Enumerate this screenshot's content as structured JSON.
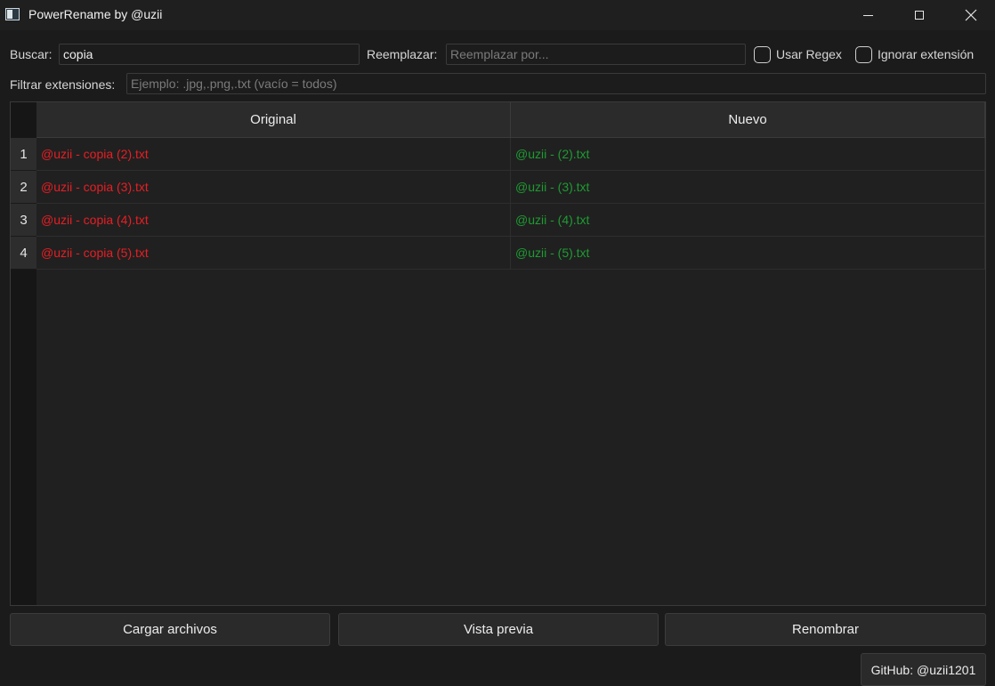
{
  "window": {
    "title": "PowerRename by @uzii",
    "controls": [
      "minimize-icon",
      "maximize-icon",
      "close-icon"
    ]
  },
  "search": {
    "label": "Buscar:",
    "value": "copia"
  },
  "replace": {
    "label": "Reemplazar:",
    "value": "",
    "placeholder": "Reemplazar por..."
  },
  "options": {
    "regex_label": "Usar Regex",
    "regex_checked": false,
    "ignore_ext_label": "Ignorar extensión",
    "ignore_ext_checked": false
  },
  "filter": {
    "label": "Filtrar extensiones:",
    "value": "",
    "placeholder": "Ejemplo: .jpg,.png,.txt (vacío = todos)"
  },
  "table": {
    "columns": [
      "Original",
      "Nuevo"
    ],
    "rows": [
      {
        "num": "1",
        "original": "@uzii - copia (2).txt",
        "new": "@uzii -  (2).txt"
      },
      {
        "num": "2",
        "original": "@uzii - copia (3).txt",
        "new": "@uzii -  (3).txt"
      },
      {
        "num": "3",
        "original": "@uzii - copia (4).txt",
        "new": "@uzii -  (4).txt"
      },
      {
        "num": "4",
        "original": "@uzii - copia (5).txt",
        "new": "@uzii -  (5).txt"
      }
    ]
  },
  "buttons": {
    "load": "Cargar archivos",
    "preview": "Vista previa",
    "rename": "Renombrar",
    "github": "GitHub: @uzii1201"
  },
  "colors": {
    "original_text": "#e81e24",
    "new_text": "#1e9b32"
  }
}
